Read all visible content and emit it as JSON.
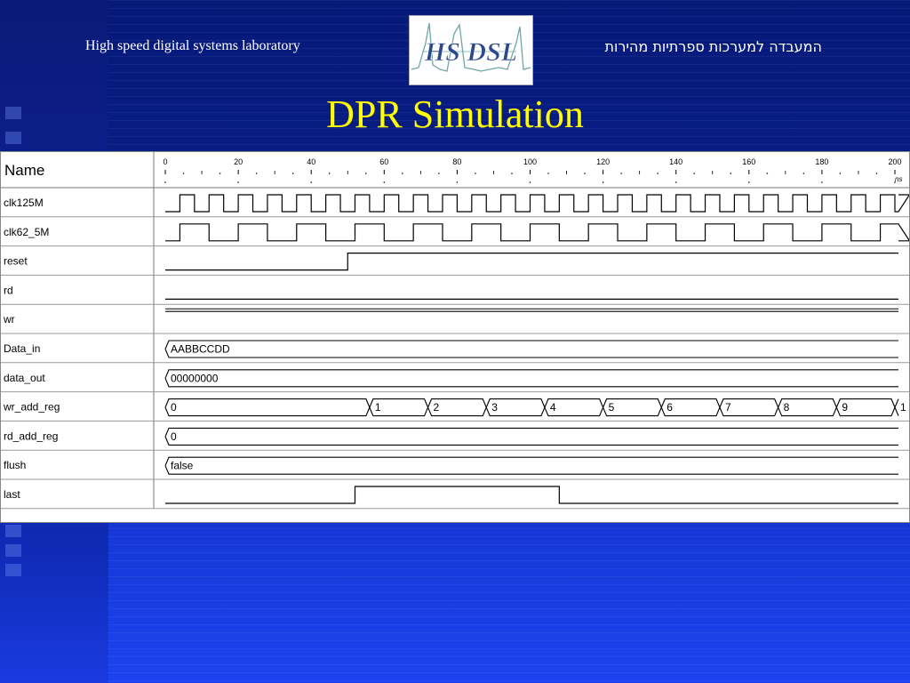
{
  "header": {
    "lab_name": "High speed digital systems laboratory",
    "lab_name_hebrew": "המעבדה למערכות ספרתיות מהירות",
    "logo_text": "HS DSL"
  },
  "slide": {
    "title": "DPR Simulation"
  },
  "waveform": {
    "name_header": "Name",
    "time_unit": "ns",
    "time_ticks": [
      "0",
      "20",
      "40",
      "60",
      "80",
      "100",
      "120",
      "140",
      "160",
      "180",
      "200"
    ],
    "signals": [
      {
        "name": "clk125M",
        "kind": "clock",
        "period_ns": 8
      },
      {
        "name": "clk62_5M",
        "kind": "clock",
        "period_ns": 16
      },
      {
        "name": "reset",
        "kind": "bit",
        "edges": [
          {
            "t": 0,
            "v": 0
          },
          {
            "t": 50,
            "v": 1
          }
        ]
      },
      {
        "name": "rd",
        "kind": "bit",
        "edges": [
          {
            "t": 0,
            "v": 0
          }
        ]
      },
      {
        "name": "wr",
        "kind": "bit",
        "edges": [
          {
            "t": 0,
            "v": 1
          }
        ]
      },
      {
        "name": "Data_in",
        "kind": "bus",
        "segments": [
          {
            "t": 0,
            "label": "AABBCCDD"
          }
        ]
      },
      {
        "name": "data_out",
        "kind": "bus",
        "segments": [
          {
            "t": 0,
            "label": "00000000"
          }
        ]
      },
      {
        "name": "wr_add_reg",
        "kind": "bus",
        "segments": [
          {
            "t": 0,
            "label": "0"
          },
          {
            "t": 56,
            "label": "1"
          },
          {
            "t": 72,
            "label": "2"
          },
          {
            "t": 88,
            "label": "3"
          },
          {
            "t": 104,
            "label": "4"
          },
          {
            "t": 120,
            "label": "5"
          },
          {
            "t": 136,
            "label": "6"
          },
          {
            "t": 152,
            "label": "7"
          },
          {
            "t": 168,
            "label": "8"
          },
          {
            "t": 184,
            "label": "9"
          },
          {
            "t": 200,
            "label": "1"
          }
        ]
      },
      {
        "name": "rd_add_reg",
        "kind": "bus",
        "segments": [
          {
            "t": 0,
            "label": "0"
          }
        ]
      },
      {
        "name": "flush",
        "kind": "bus",
        "segments": [
          {
            "t": 0,
            "label": "false"
          }
        ]
      },
      {
        "name": "last",
        "kind": "bit",
        "edges": [
          {
            "t": 0,
            "v": 0
          },
          {
            "t": 52,
            "v": 1
          },
          {
            "t": 108,
            "v": 0
          }
        ]
      }
    ]
  }
}
